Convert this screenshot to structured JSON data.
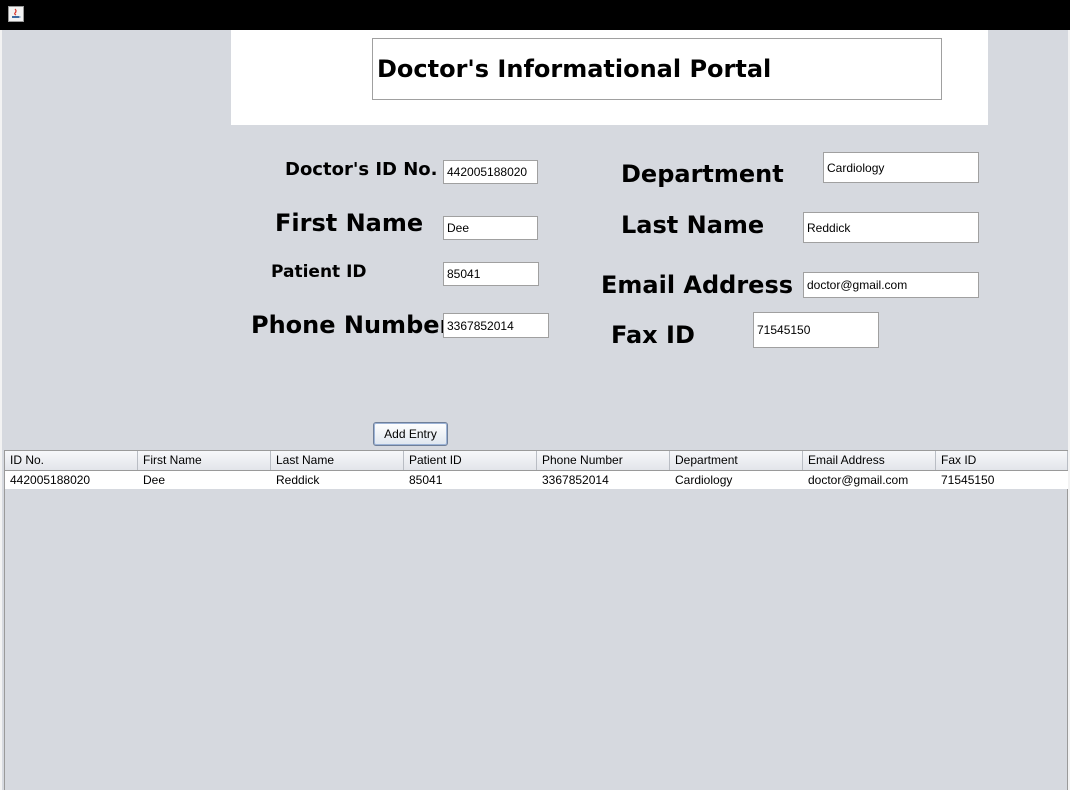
{
  "app": {
    "title": "Doctor's Informational Portal"
  },
  "labels": {
    "doctor_id": "Doctor's ID No.",
    "first_name": "First Name",
    "patient_id": "Patient ID",
    "phone": "Phone Number",
    "department": "Department",
    "last_name": "Last Name",
    "email": "Email Address",
    "fax": "Fax ID"
  },
  "fields": {
    "doctor_id": "442005188020",
    "first_name": "Dee",
    "patient_id": "85041",
    "phone": "3367852014",
    "department": "Cardiology",
    "last_name": "Reddick",
    "email": "doctor@gmail.com",
    "fax": "71545150"
  },
  "button": {
    "add_entry": "Add Entry"
  },
  "table": {
    "headers": [
      "ID No.",
      "First Name",
      "Last Name",
      "Patient ID",
      "Phone Number",
      "Department",
      "Email Address",
      "Fax ID"
    ],
    "rows": [
      [
        "442005188020",
        "Dee",
        "Reddick",
        "85041",
        "3367852014",
        "Cardiology",
        "doctor@gmail.com",
        "71545150"
      ]
    ]
  }
}
